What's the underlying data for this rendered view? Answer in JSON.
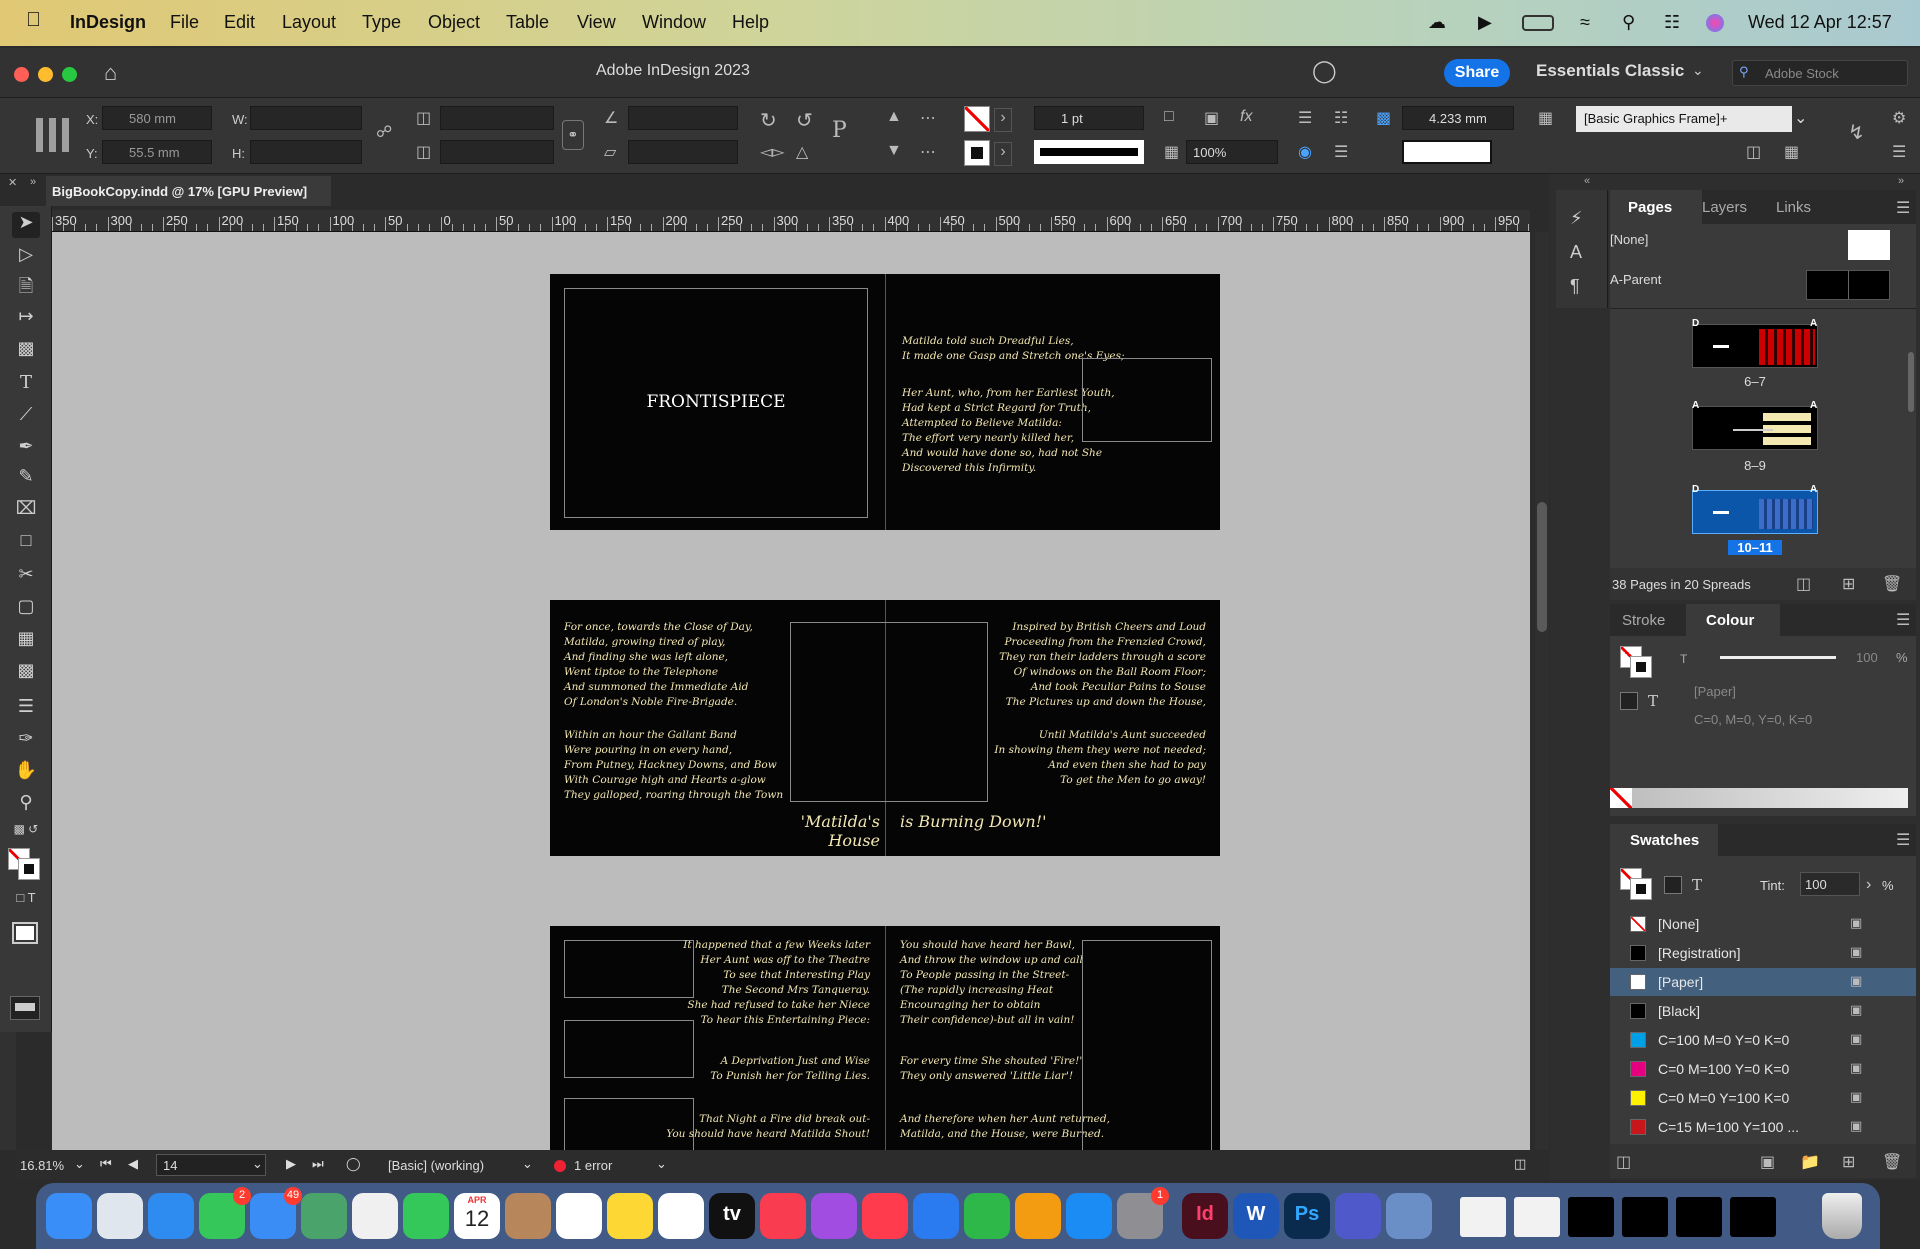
{
  "menubar": {
    "app_name": "InDesign",
    "menus": [
      "File",
      "Edit",
      "Layout",
      "Type",
      "Object",
      "Table",
      "View",
      "Window",
      "Help"
    ],
    "clock": "Wed 12 Apr  12:57"
  },
  "titlebar": {
    "title": "Adobe InDesign 2023",
    "share_label": "Share",
    "workspace": "Essentials Classic",
    "stock_placeholder": "Adobe Stock"
  },
  "control": {
    "x_label": "X:",
    "x_value": "580 mm",
    "y_label": "Y:",
    "y_value": "55.5 mm",
    "w_label": "W:",
    "h_label": "H:",
    "stroke_weight": "1 pt",
    "opacity": "100%",
    "gap": "4.233 mm",
    "object_style": "[Basic Graphics Frame]+"
  },
  "document": {
    "tab_title": "BigBookCopy.indd @ 17% [GPU Preview]"
  },
  "ruler": {
    "labels": [
      "350",
      "300",
      "250",
      "200",
      "150",
      "100",
      "50",
      "0",
      "50",
      "100",
      "150",
      "200",
      "250",
      "300",
      "350",
      "400",
      "450",
      "500",
      "550",
      "600",
      "650",
      "700",
      "750",
      "800",
      "850",
      "900",
      "950"
    ]
  },
  "spread1": {
    "frontispiece": "FRONTISPIECE",
    "stanza1": "Matilda told such Dreadful Lies,\nIt made one Gasp and Stretch one's Eyes;",
    "stanza2": "Her Aunt, who, from her Earliest Youth,\nHad kept a Strict Regard for Truth,\nAttempted to Believe Matilda:\nThe effort very nearly killed her,\nAnd would have done so, had not She\nDiscovered this Infirmity."
  },
  "spread2": {
    "left1": "For once, towards the Close of Day,\nMatilda, growing tired of play,\nAnd finding she was left alone,\nWent tiptoe to the Telephone\nAnd summoned the Immediate Aid\nOf London's Noble Fire-Brigade.",
    "left2": "Within an hour the Gallant Band\nWere pouring in on every hand,\nFrom Putney, Hackney Downs, and Bow\nWith Courage high and Hearts a-glow\nThey galloped, roaring through the Town",
    "headline_left": "'Matilda's House",
    "headline_right": "is Burning Down!'",
    "right1": "Inspired by British Cheers and Loud\nProceeding from the Frenzied Crowd,\nThey ran their ladders through a score\nOf windows on the Ball Room Floor;\nAnd took Peculiar Pains to Souse\nThe Pictures up and down the House,",
    "right2": "Until Matilda's Aunt succeeded\nIn showing them they were not needed;\nAnd even then she had to pay\nTo get the Men to go away!"
  },
  "spread3": {
    "l1": "It happened that a few Weeks later\nHer Aunt was off to the Theatre\nTo see that Interesting Play\nThe Second Mrs Tanqueray.\nShe had refused to take her Niece\nTo hear this Entertaining Piece:",
    "l2": "A Deprivation Just and Wise\nTo Punish her for Telling Lies.",
    "l3": "That Night a Fire did break out-\nYou should have heard Matilda Shout!",
    "r1": "You should have heard her Bawl,\nAnd throw the window up and call\nTo People passing in the Street-\n(The rapidly increasing Heat\nEncouraging her to obtain\nTheir confidence)-but all in vain!",
    "r2": "For every time She shouted 'Fire!'\nThey only answered 'Little Liar'!",
    "r3": "And therefore when her Aunt returned,\nMatilda, and the House, were Burned."
  },
  "status": {
    "zoom": "16.81%",
    "page": "14",
    "preflight_profile": "[Basic] (working)",
    "errors": "1 error"
  },
  "pages_panel": {
    "tabs": [
      "Pages",
      "Layers",
      "Links"
    ],
    "none_label": "[None]",
    "parent_label": "A-Parent",
    "spreads": [
      {
        "label": "6–7",
        "left_tag": "D",
        "right_tag": "A"
      },
      {
        "label": "8–9",
        "left_tag": "A",
        "right_tag": "A"
      },
      {
        "label": "10–11",
        "left_tag": "D",
        "right_tag": "A"
      }
    ],
    "summary": "38 Pages in 20 Spreads"
  },
  "colour_panel": {
    "tabs": [
      "Stroke",
      "Colour"
    ],
    "tint_label": "T",
    "tint_value": "100",
    "percent": "%",
    "swatch_name": "[Paper]",
    "cmyk": "C=0, M=0, Y=0, K=0"
  },
  "swatches_panel": {
    "title": "Swatches",
    "tint_label": "Tint:",
    "tint_value": "100",
    "percent": "%",
    "items": [
      {
        "name": "[None]",
        "color": "#ffffff"
      },
      {
        "name": "[Registration]",
        "color": "#000000"
      },
      {
        "name": "[Paper]",
        "color": "#ffffff"
      },
      {
        "name": "[Black]",
        "color": "#000000"
      },
      {
        "name": "C=100 M=0 Y=0 K=0",
        "color": "#00a0e9"
      },
      {
        "name": "C=0 M=100 Y=0 K=0",
        "color": "#e4007f"
      },
      {
        "name": "C=0 M=0 Y=100 K=0",
        "color": "#fff100"
      },
      {
        "name": "C=15 M=100 Y=100 ...",
        "color": "#c8161d"
      }
    ]
  },
  "dock": {
    "badges": {
      "messages": "2",
      "mail": "49",
      "settings": "1"
    },
    "calendar_month": "APR",
    "calendar_day": "12",
    "apps": [
      "Finder",
      "Launchpad",
      "Safari",
      "Messages",
      "Mail",
      "Maps",
      "Photos",
      "FaceTime",
      "Calendar",
      "Contacts",
      "Reminders",
      "Notes",
      "Freeform",
      "TV",
      "Music",
      "Podcasts",
      "News",
      "Keynote",
      "Numbers",
      "Pages",
      "App Store",
      "System Settings",
      "InDesign",
      "Word",
      "Photoshop",
      "Teams",
      "Preview"
    ],
    "labels": {
      "tv": "tv",
      "indesign": "Id",
      "word": "W",
      "photoshop": "Ps"
    }
  }
}
